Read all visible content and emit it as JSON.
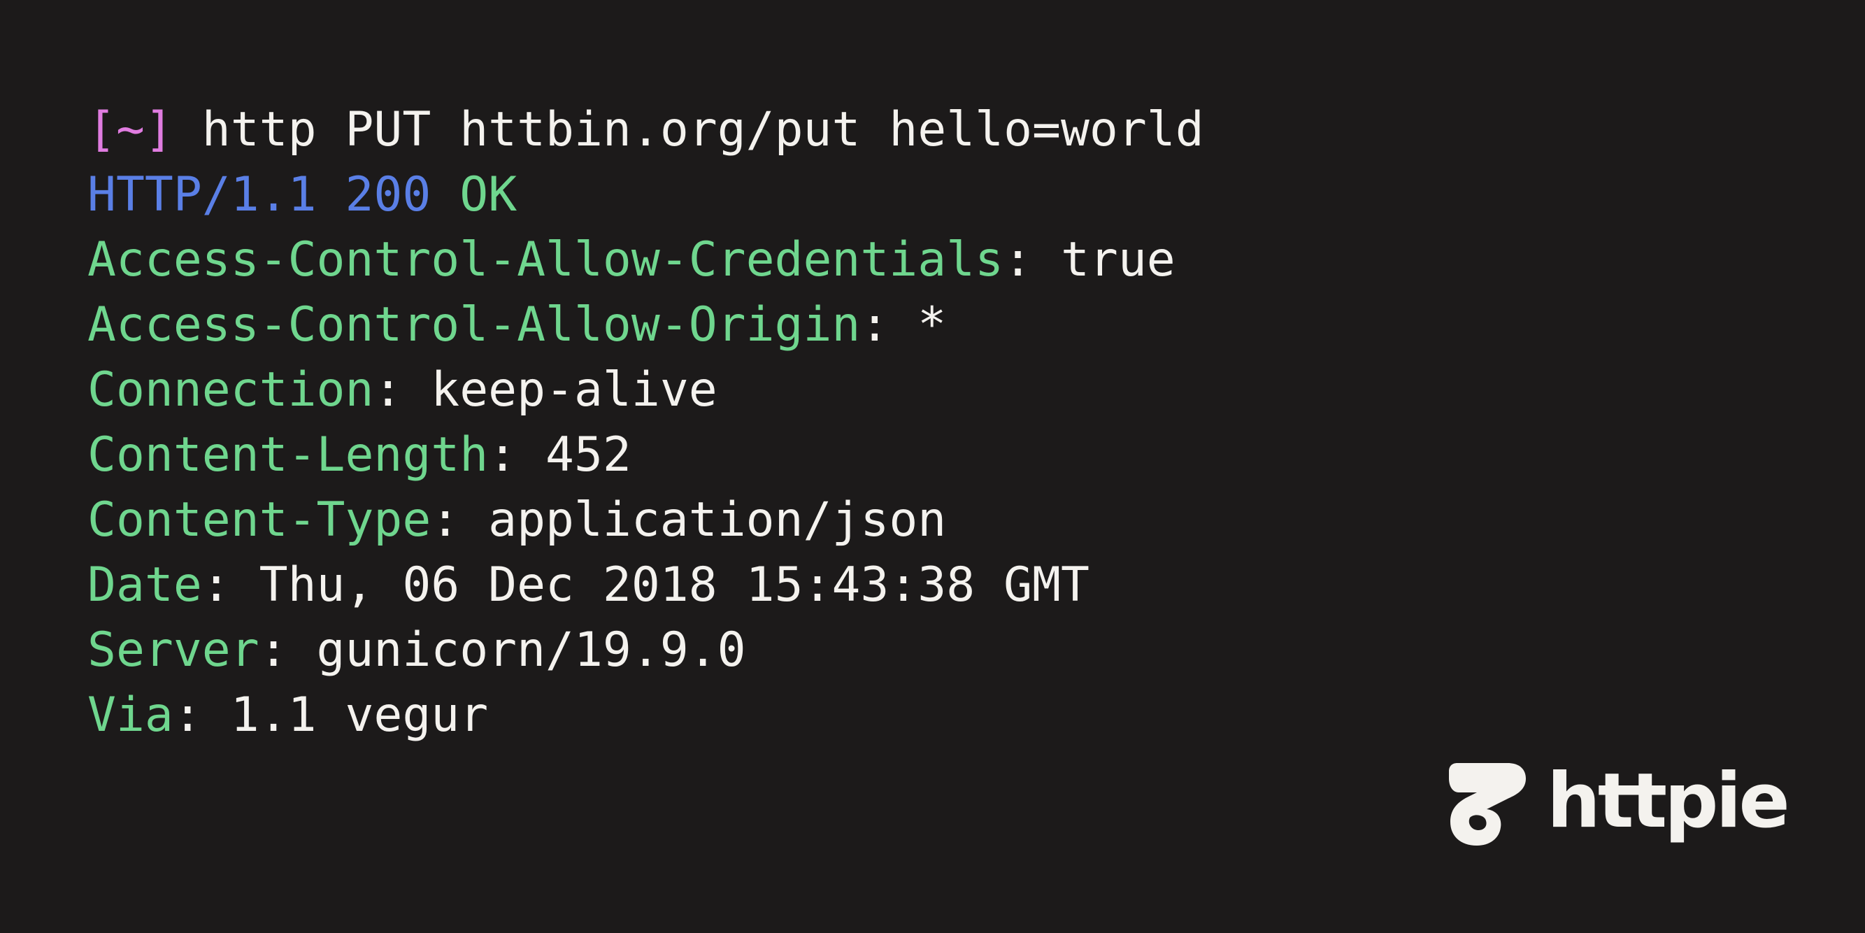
{
  "terminal": {
    "prompt": "[~]",
    "command": "http PUT httbin.org/put hello=world",
    "status": {
      "protocol": "HTTP/1.1",
      "code": "200",
      "text": "OK"
    },
    "headers": [
      {
        "key": "Access-Control-Allow-Credentials",
        "sep": ": ",
        "value": "true"
      },
      {
        "key": "Access-Control-Allow-Origin",
        "sep": ": ",
        "value": "*"
      },
      {
        "key": "Connection",
        "sep": ": ",
        "value": "keep-alive"
      },
      {
        "key": "Content-Length",
        "sep": ": ",
        "value": "452"
      },
      {
        "key": "Content-Type",
        "sep": ": ",
        "value": "application/json"
      },
      {
        "key": "Date",
        "sep": ": ",
        "value": "Thu, 06 Dec 2018 15:43:38 GMT"
      },
      {
        "key": "Server",
        "sep": ": ",
        "value": "gunicorn/19.9.0"
      },
      {
        "key": "Via",
        "sep": ": ",
        "value": "1.1 vegur"
      }
    ]
  },
  "brand": {
    "name": "httpie",
    "icon": "httpie-logo-icon"
  },
  "colors": {
    "background": "#1c1a1a",
    "text": "#f4f2ee",
    "prompt": "#e07ce0",
    "status_line": "#5a7fe6",
    "header_key": "#6fd68e"
  }
}
